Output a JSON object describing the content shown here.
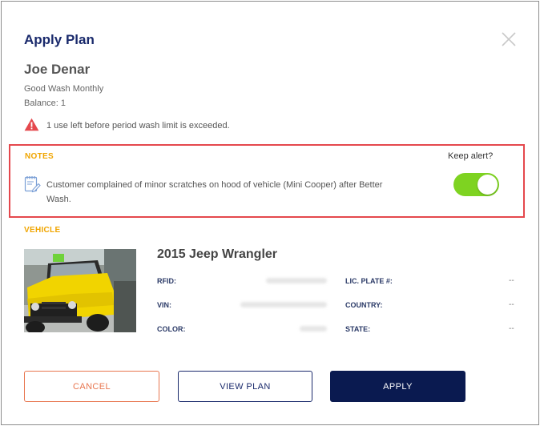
{
  "dialog": {
    "title": "Apply Plan"
  },
  "customer": {
    "name": "Joe Denar",
    "plan": "Good Wash Monthly",
    "balance": "Balance: 1",
    "warning": "1 use left before period wash limit is exceeded."
  },
  "notes": {
    "label": "NOTES",
    "keep_alert_label": "Keep alert?",
    "keep_alert_on": true,
    "text": "Customer complained of minor scratches on hood of vehicle (Mini Cooper) after Better Wash."
  },
  "vehicle": {
    "label": "VEHICLE",
    "title": "2015 Jeep Wrangler",
    "fields": {
      "rfid_label": "RFID:",
      "vin_label": "VIN:",
      "color_label": "COLOR:",
      "plate_label": "LIC. PLATE #:",
      "plate_value": "--",
      "country_label": "COUNTRY:",
      "country_value": "--",
      "state_label": "STATE:",
      "state_value": "--"
    }
  },
  "actions": {
    "cancel": "CANCEL",
    "view_plan": "VIEW PLAN",
    "apply": "APPLY"
  },
  "colors": {
    "title": "#1a2a6c",
    "accent_label": "#f0a500",
    "highlight_border": "#e5484d",
    "toggle_on": "#7ed321",
    "cancel": "#e8764f",
    "apply_bg": "#0a1a50"
  },
  "icons": {
    "close": "close-icon",
    "warning": "warning-triangle-icon",
    "note": "note-pencil-icon"
  }
}
